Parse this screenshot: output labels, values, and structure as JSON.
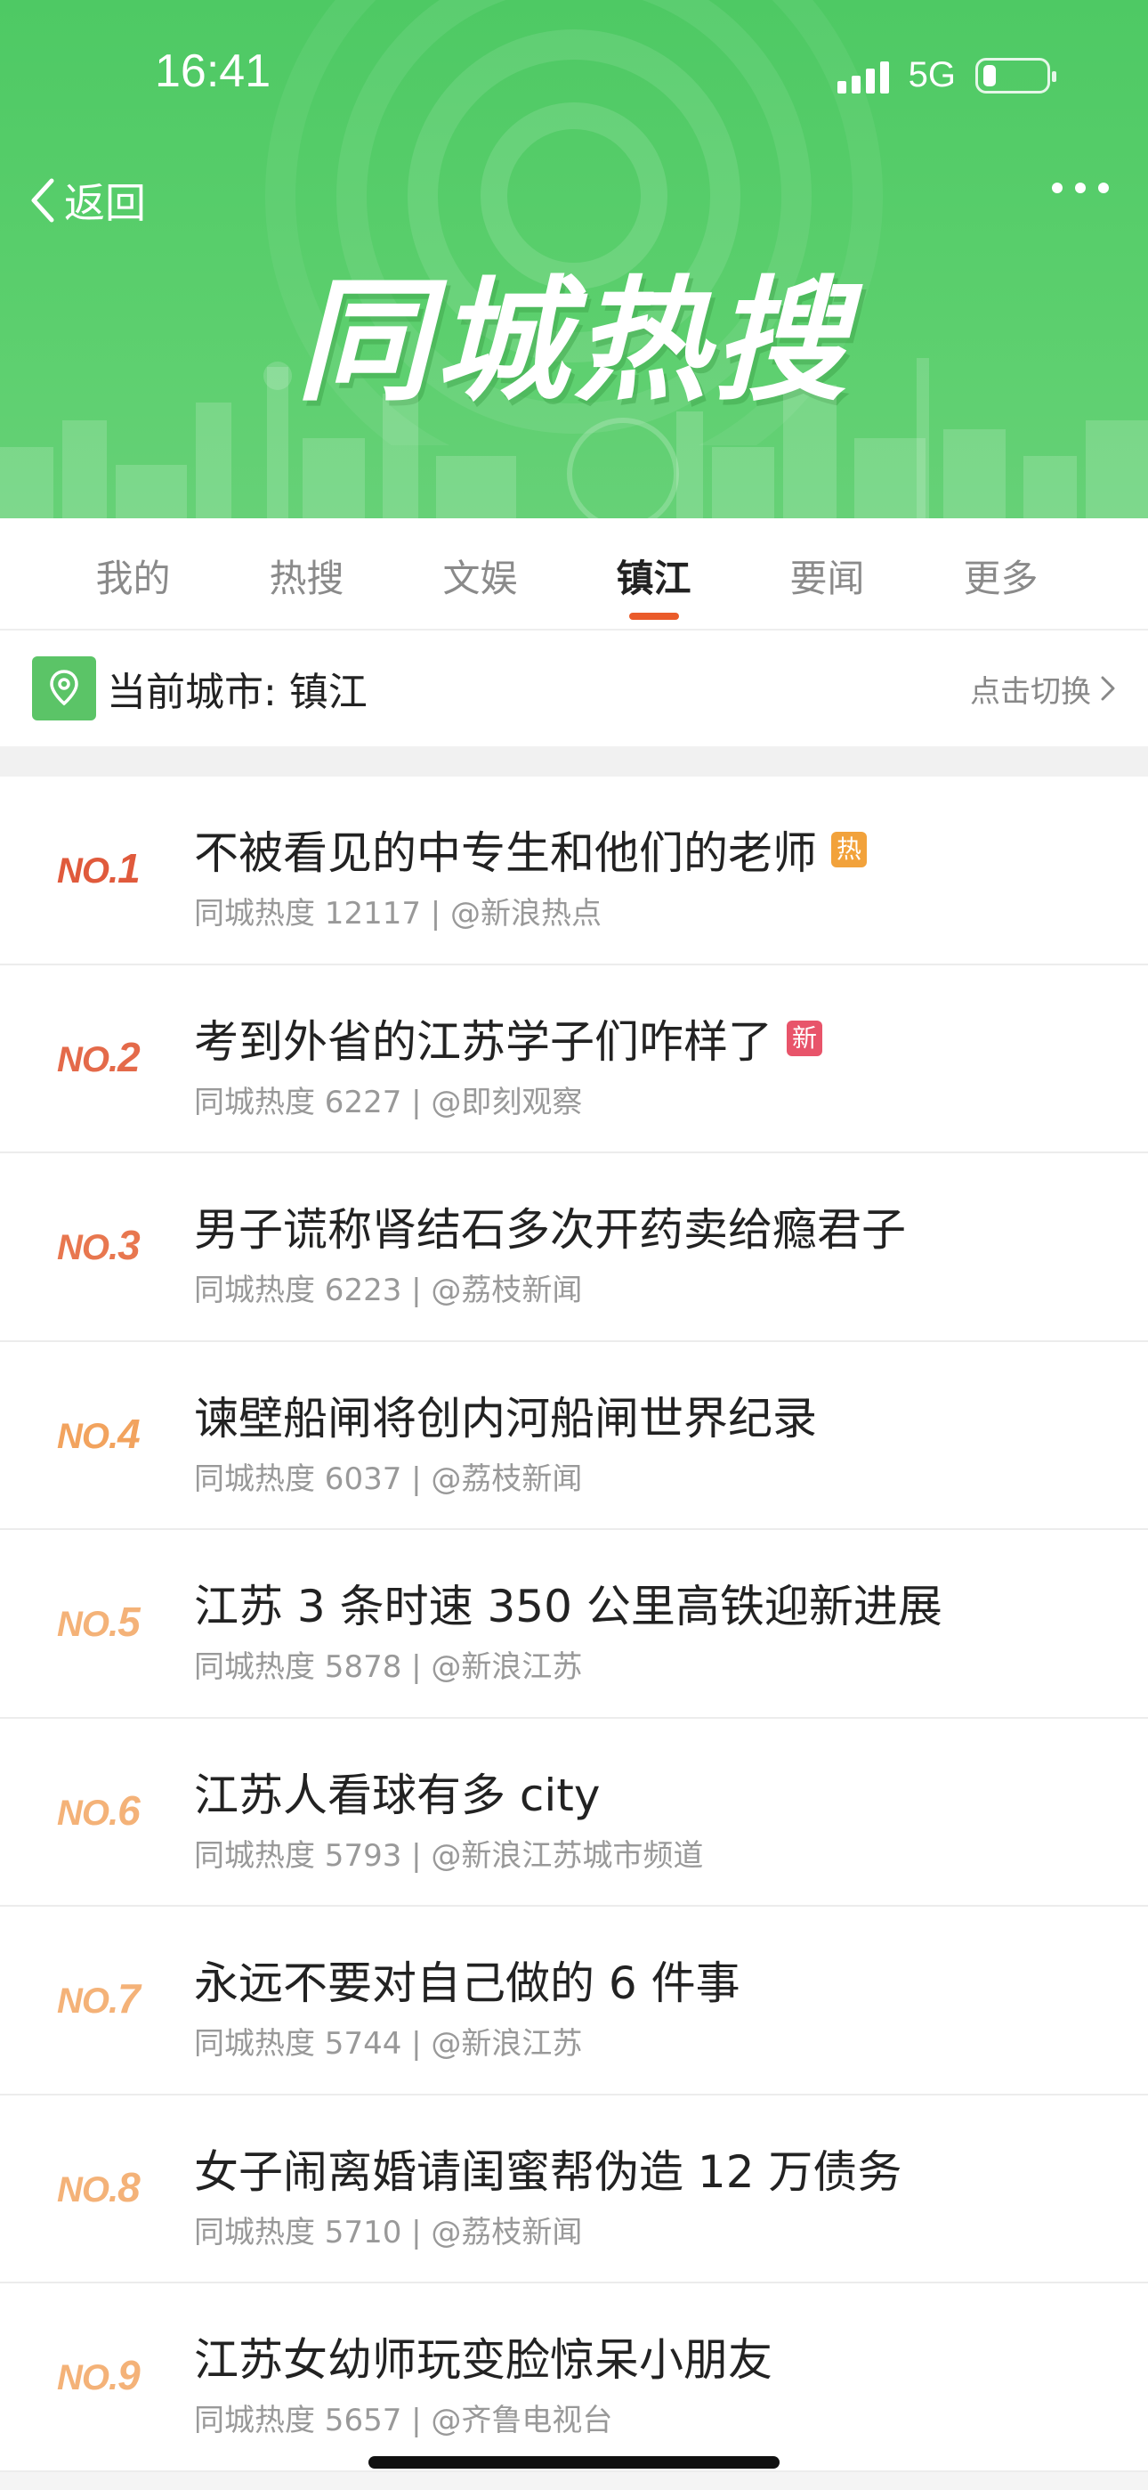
{
  "status_bar": {
    "time": "16:41",
    "network": "5G",
    "battery_level": 0.2
  },
  "header": {
    "back_label": "返回",
    "banner_title": "同城热搜"
  },
  "tabs": [
    {
      "label": "我的",
      "active": false
    },
    {
      "label": "热搜",
      "active": false
    },
    {
      "label": "文娱",
      "active": false
    },
    {
      "label": "镇江",
      "active": true
    },
    {
      "label": "要闻",
      "active": false
    },
    {
      "label": "更多",
      "active": false
    }
  ],
  "city": {
    "label": "当前城市: 镇江",
    "switch_label": "点击切换"
  },
  "colors": {
    "header_green": "#5bcf6d",
    "active_tab_underline": "#ea5b2a",
    "badge_hot": "#f2a23b",
    "badge_new": "#e8546a"
  },
  "list": [
    {
      "rank_no": "NO.",
      "rank_num": "1",
      "rank_color": "#e05a3c",
      "title": "不被看见的中专生和他们的老师",
      "badge": "热",
      "badge_color": "#f2a23b",
      "meta": "同城热度 12117 | @新浪热点"
    },
    {
      "rank_no": "NO.",
      "rank_num": "2",
      "rank_color": "#e46a4a",
      "title": "考到外省的江苏学子们咋样了",
      "badge": "新",
      "badge_color": "#e8546a",
      "meta": "同城热度 6227 | @即刻观察"
    },
    {
      "rank_no": "NO.",
      "rank_num": "3",
      "rank_color": "#e8774f",
      "title": "男子谎称肾结石多次开药卖给瘾君子",
      "badge": "",
      "badge_color": "",
      "meta": "同城热度 6223 | @荔枝新闻"
    },
    {
      "rank_no": "NO.",
      "rank_num": "4",
      "rank_color": "#f2a35e",
      "title": "谏壁船闸将创内河船闸世界纪录",
      "badge": "",
      "badge_color": "",
      "meta": "同城热度 6037 | @荔枝新闻"
    },
    {
      "rank_no": "NO.",
      "rank_num": "5",
      "rank_color": "#f4b278",
      "title": "江苏 3 条时速 350 公里高铁迎新进展",
      "badge": "",
      "badge_color": "",
      "meta": "同城热度 5878 | @新浪江苏"
    },
    {
      "rank_no": "NO.",
      "rank_num": "6",
      "rank_color": "#f4b278",
      "title": "江苏人看球有多 city",
      "badge": "",
      "badge_color": "",
      "meta": "同城热度 5793 | @新浪江苏城市频道"
    },
    {
      "rank_no": "NO.",
      "rank_num": "7",
      "rank_color": "#f4b278",
      "title": "永远不要对自己做的 6 件事",
      "badge": "",
      "badge_color": "",
      "meta": "同城热度 5744 | @新浪江苏"
    },
    {
      "rank_no": "NO.",
      "rank_num": "8",
      "rank_color": "#f4b278",
      "title": "女子闹离婚请闺蜜帮伪造 12 万债务",
      "badge": "",
      "badge_color": "",
      "meta": "同城热度 5710 | @荔枝新闻"
    },
    {
      "rank_no": "NO.",
      "rank_num": "9",
      "rank_color": "#f4b278",
      "title": "江苏女幼师玩变脸惊呆小朋友",
      "badge": "",
      "badge_color": "",
      "meta": "同城热度 5657 | @齐鲁电视台"
    }
  ]
}
